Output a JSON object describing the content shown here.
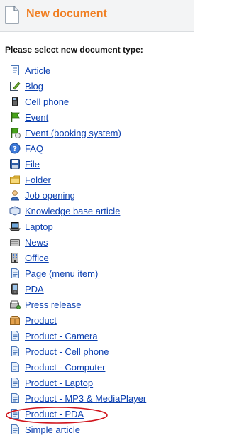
{
  "header": {
    "title": "New document",
    "icon": "document-icon"
  },
  "prompt": "Please select new document type:",
  "items": [
    {
      "label": "Article",
      "icon": "article-icon"
    },
    {
      "label": "Blog",
      "icon": "blog-icon"
    },
    {
      "label": "Cell phone",
      "icon": "cell-phone-icon"
    },
    {
      "label": "Event",
      "icon": "event-flag-icon"
    },
    {
      "label": "Event (booking system)",
      "icon": "booking-event-icon"
    },
    {
      "label": "FAQ",
      "icon": "help-icon"
    },
    {
      "label": "File",
      "icon": "floppy-icon"
    },
    {
      "label": "Folder",
      "icon": "folder-icon"
    },
    {
      "label": "Job opening",
      "icon": "person-icon"
    },
    {
      "label": "Knowledge base article",
      "icon": "book-icon"
    },
    {
      "label": "Laptop",
      "icon": "laptop-icon"
    },
    {
      "label": "News",
      "icon": "news-icon"
    },
    {
      "label": "Office",
      "icon": "office-icon"
    },
    {
      "label": "Page (menu item)",
      "icon": "page-icon"
    },
    {
      "label": "PDA",
      "icon": "pda-icon"
    },
    {
      "label": "Press release",
      "icon": "press-release-icon"
    },
    {
      "label": "Product",
      "icon": "product-icon"
    },
    {
      "label": "Product - Camera",
      "icon": "page-icon"
    },
    {
      "label": "Product - Cell phone",
      "icon": "page-icon"
    },
    {
      "label": "Product - Computer",
      "icon": "page-icon"
    },
    {
      "label": "Product - Laptop",
      "icon": "page-icon"
    },
    {
      "label": "Product - MP3 & MediaPlayer",
      "icon": "page-icon"
    },
    {
      "label": "Product - PDA",
      "icon": "page-icon"
    },
    {
      "label": "Simple article",
      "icon": "page-icon"
    }
  ],
  "colors": {
    "title": "#f07f23",
    "link": "#0b3fb0",
    "highlight": "#d0141c",
    "header_bg": "#f3f4f5"
  }
}
